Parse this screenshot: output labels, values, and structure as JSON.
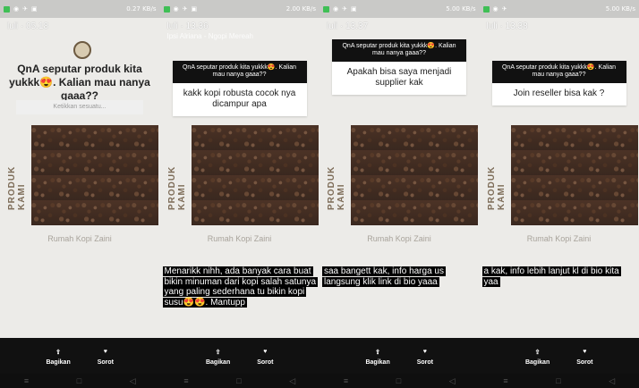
{
  "statusbar": {
    "left_icons": [
      "green-app",
      "instagram",
      "messenger",
      "gallery"
    ],
    "right_text_1": "0.27 KB/s",
    "right_text_2": "2.00 KB/s",
    "right_text_3": "5.00 KB/s"
  },
  "panels": [
    {
      "meta": "luli · 05.18",
      "sub": "",
      "qna_head": "",
      "question": "QnA seputar produk kita yukkk😍. Kalian mau nanya gaaa??",
      "input_placeholder": "Ketikkan sesuatu...",
      "rumah": "Rumah Kopi Zaini",
      "overlay": ""
    },
    {
      "meta": "luli · 13.36",
      "sub": "Ipsi Alriana - Ngopi Mereah",
      "qna_head": "QnA seputar produk kita yukkk😍. Kalian mau nanya gaaa??",
      "question": "kakk kopi robusta cocok nya dicampur apa",
      "rumah": "Rumah Kopi Zaini",
      "overlay": "Menarikk nihh, ada banyak cara buat bikin minuman dari kopi salah satunya yang paling sederhana tu bikin kopi susu😍😍. Mantupp"
    },
    {
      "meta": "luli · 13.37",
      "sub": "",
      "qna_head": "QnA seputar produk kita yukkk😍. Kalian mau nanya gaaa??",
      "question": "Apakah bisa saya menjadi supplier kak",
      "rumah": "Rumah Kopi Zaini",
      "overlay": "saa bangett kak, info harga us langsung klik link di bio yaaa"
    },
    {
      "meta": "luli · 13.38",
      "sub": "",
      "qna_head": "QnA seputar produk kita yukkk😍. Kalian mau nanya gaaa??",
      "question": "Join reseller bisa kak ?",
      "rumah": "Rumah Kopi Zaini",
      "overlay": "a kak, info lebih lanjut kl di bio kita yaa"
    }
  ],
  "actions": {
    "share": "Bagikan",
    "highlight": "Sorot"
  },
  "side_text": "PRODUK KAMI"
}
